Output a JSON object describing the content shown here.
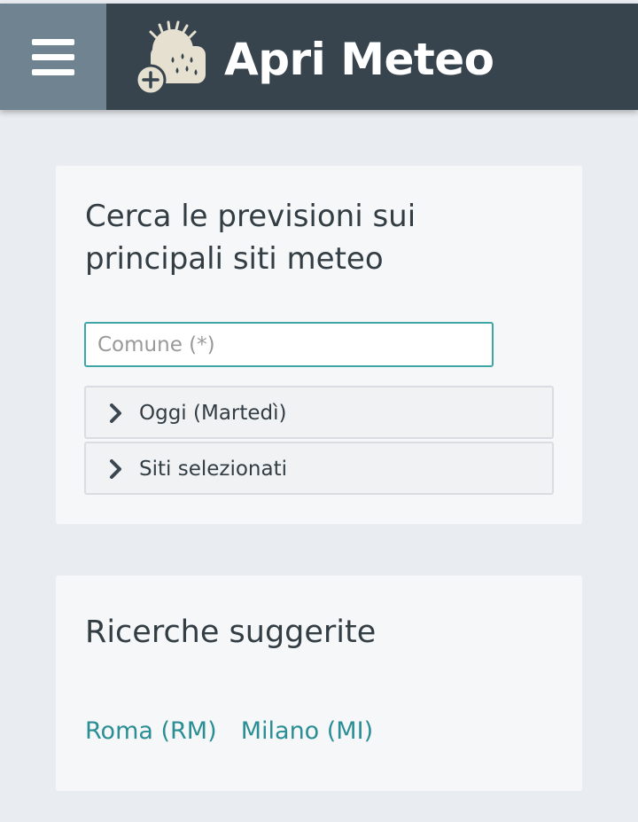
{
  "header": {
    "title": "Apri Meteo",
    "menu_icon": "hamburger-icon",
    "logo_icon": "weather-sun-rain-icon"
  },
  "search_card": {
    "title": "Cerca le previsioni sui principali siti meteo",
    "input": {
      "placeholder": "Comune (*)",
      "value": ""
    },
    "accordions": [
      {
        "label": "Oggi (Martedì)",
        "icon": "chevron-right-icon"
      },
      {
        "label": "Siti selezionati",
        "icon": "chevron-right-icon"
      }
    ]
  },
  "suggest_card": {
    "title": "Ricerche suggerite",
    "links": [
      {
        "label": "Roma (RM)"
      },
      {
        "label": "Milano (MI)"
      }
    ]
  },
  "colors": {
    "header_bg": "#37444e",
    "menu_bg": "#6f8390",
    "accent": "#3ea7a6",
    "link": "#2a8e94",
    "page_bg": "#e9ecf0",
    "card_bg": "#f6f7f9"
  }
}
